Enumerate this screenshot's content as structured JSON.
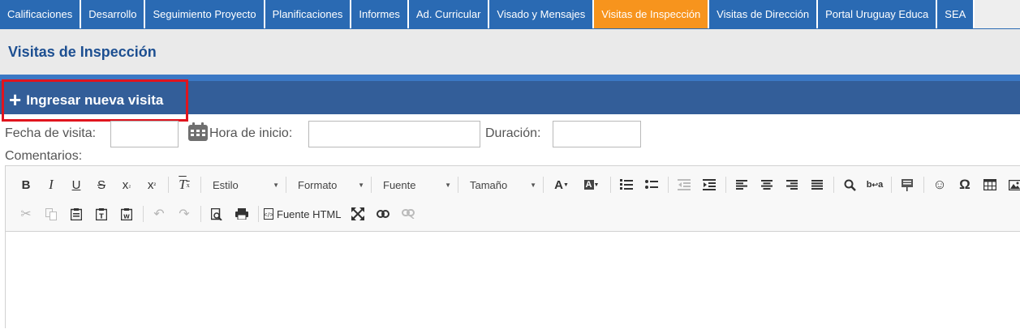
{
  "tabs": [
    {
      "label": "Calificaciones",
      "active": false
    },
    {
      "label": "Desarrollo",
      "active": false
    },
    {
      "label": "Seguimiento Proyecto",
      "active": false
    },
    {
      "label": "Planificaciones",
      "active": false
    },
    {
      "label": "Informes",
      "active": false
    },
    {
      "label": "Ad. Curricular",
      "active": false
    },
    {
      "label": "Visado y Mensajes",
      "active": false
    },
    {
      "label": "Visitas de Inspección",
      "active": true
    },
    {
      "label": "Visitas de Dirección",
      "active": false
    },
    {
      "label": "Portal Uruguay Educa",
      "active": false
    },
    {
      "label": "SEA",
      "active": false
    }
  ],
  "page": {
    "title": "Visitas de Inspección"
  },
  "section": {
    "action_label": "Ingresar nueva visita",
    "action_icon": "plus-icon"
  },
  "form": {
    "date_label": "Fecha de visita:",
    "date_value": "",
    "start_label": "Hora de inicio:",
    "start_value": "",
    "duration_label": "Duración:",
    "duration_value": "",
    "comments_label": "Comentarios:"
  },
  "editor": {
    "style_label": "Estilo",
    "format_label": "Formato",
    "font_label": "Fuente",
    "size_label": "Tamaño",
    "source_label": "Fuente HTML"
  },
  "colors": {
    "tab_bg": "#2a6ab3",
    "tab_active": "#f7941d",
    "section_bar": "#335e99",
    "highlight": "#e0141e"
  }
}
